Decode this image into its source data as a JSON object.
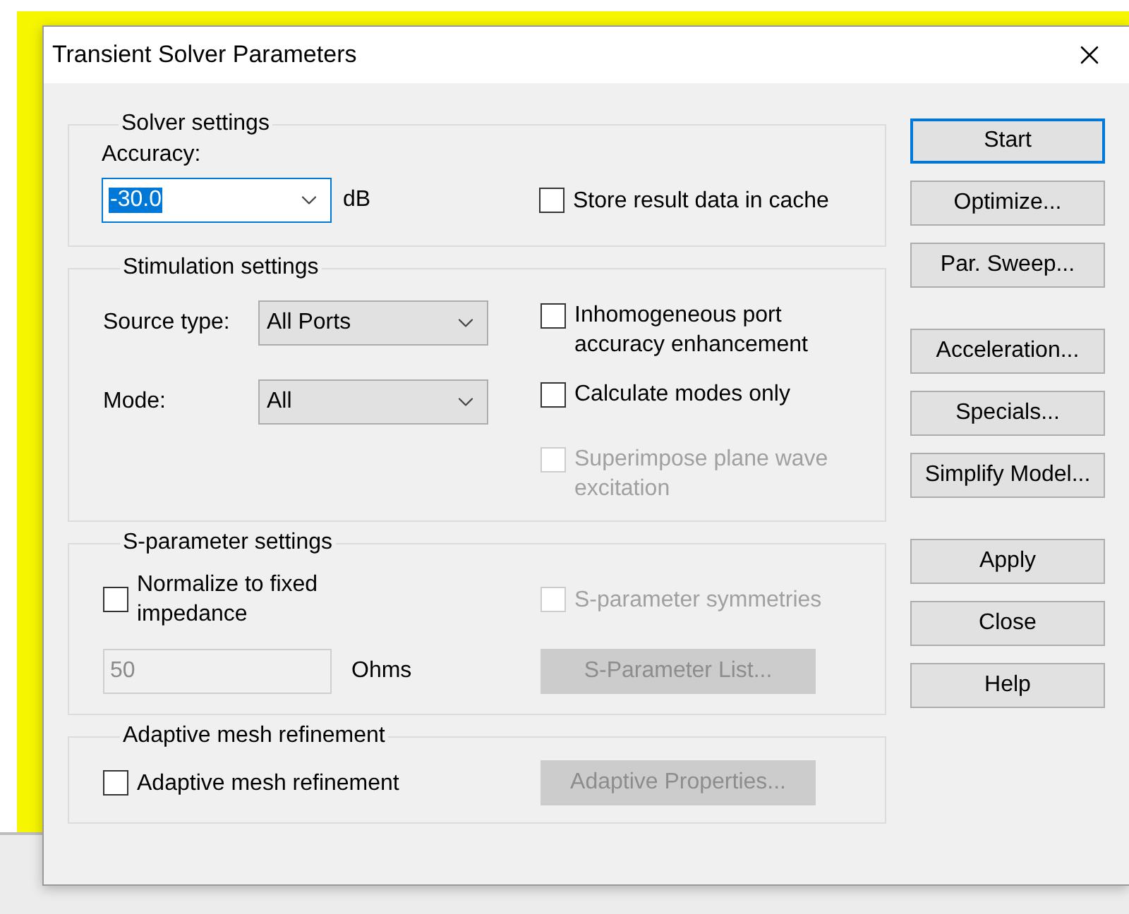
{
  "window": {
    "title": "Transient Solver Parameters"
  },
  "solver_settings": {
    "title": "Solver settings",
    "accuracy": {
      "label": "Accuracy:",
      "value": "-30.0",
      "text_selected": true,
      "unit": "dB"
    },
    "store_cache": {
      "label": "Store result data in cache",
      "checked": false,
      "disabled": false
    }
  },
  "stimulation_settings": {
    "title": "Stimulation settings",
    "source_type": {
      "label": "Source type:",
      "value": "All Ports"
    },
    "mode": {
      "label": "Mode:",
      "value": "All"
    },
    "options": [
      {
        "label": "Inhomogeneous port accuracy enhancement",
        "checked": false,
        "disabled": false
      },
      {
        "label": "Calculate modes only",
        "checked": false,
        "disabled": false
      },
      {
        "label": "Superimpose plane wave excitation",
        "checked": false,
        "disabled": true
      }
    ]
  },
  "s_parameter_settings": {
    "title": "S-parameter settings",
    "normalize": {
      "label": "Normalize to fixed impedance",
      "checked": false,
      "disabled": false
    },
    "symmetries": {
      "label": "S-parameter symmetries",
      "checked": false,
      "disabled": true
    },
    "impedance": {
      "value": "50",
      "unit": "Ohms",
      "disabled": true
    },
    "list_button": {
      "label": "S-Parameter List...",
      "disabled": true
    }
  },
  "adaptive_mesh": {
    "title": "Adaptive mesh refinement",
    "refinement": {
      "label": "Adaptive mesh refinement",
      "checked": false,
      "disabled": false
    },
    "properties_button": {
      "label": "Adaptive Properties...",
      "disabled": true
    }
  },
  "button_groups": [
    {
      "buttons": [
        {
          "label": "Start",
          "default": true
        },
        {
          "label": "Optimize...",
          "default": false
        },
        {
          "label": "Par. Sweep...",
          "default": false
        }
      ]
    },
    {
      "buttons": [
        {
          "label": "Acceleration...",
          "default": false
        },
        {
          "label": "Specials...",
          "default": false
        },
        {
          "label": "Simplify Model...",
          "default": false
        }
      ]
    },
    {
      "buttons": [
        {
          "label": "Apply",
          "default": false
        },
        {
          "label": "Close",
          "default": false
        },
        {
          "label": "Help",
          "default": false
        }
      ]
    }
  ]
}
